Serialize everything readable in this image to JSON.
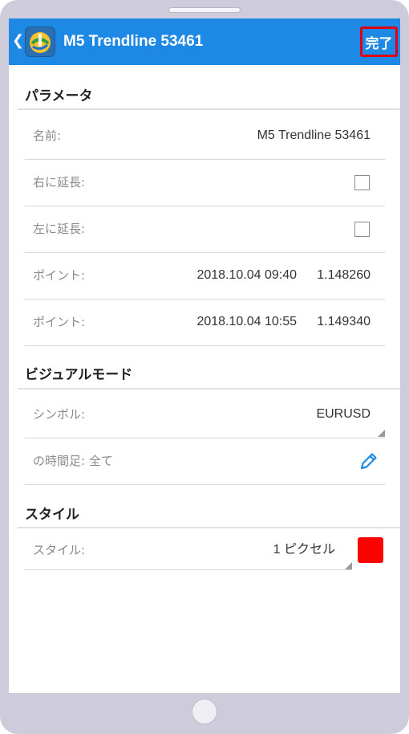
{
  "appbar": {
    "title": "M5 Trendline 53461",
    "done_label": "完了",
    "back_icon": "chevron-left-icon",
    "logo_icon": "metatrader-logo-icon"
  },
  "sections": {
    "parameters": {
      "title": "パラメータ",
      "name_label": "名前:",
      "name_value": "M5 Trendline 53461",
      "extend_right_label": "右に延長:",
      "extend_right_checked": false,
      "extend_left_label": "左に延長:",
      "extend_left_checked": false,
      "point1_label": "ポイント:",
      "point1_time": "2018.10.04 09:40",
      "point1_price": "1.148260",
      "point2_label": "ポイント:",
      "point2_time": "2018.10.04 10:55",
      "point2_price": "1.149340"
    },
    "visual": {
      "title": "ビジュアルモード",
      "symbol_label": "シンボル:",
      "symbol_value": "EURUSD",
      "timeframes_label": "の時間足: 全て",
      "edit_icon": "pencil-icon"
    },
    "style": {
      "title": "スタイル",
      "style_label": "スタイル:",
      "style_value": "1 ピクセル",
      "color": "#ff0000"
    }
  },
  "colors": {
    "appbar": "#1e88e5",
    "done_border": "#e0000f",
    "accent": "#1e88e5"
  }
}
